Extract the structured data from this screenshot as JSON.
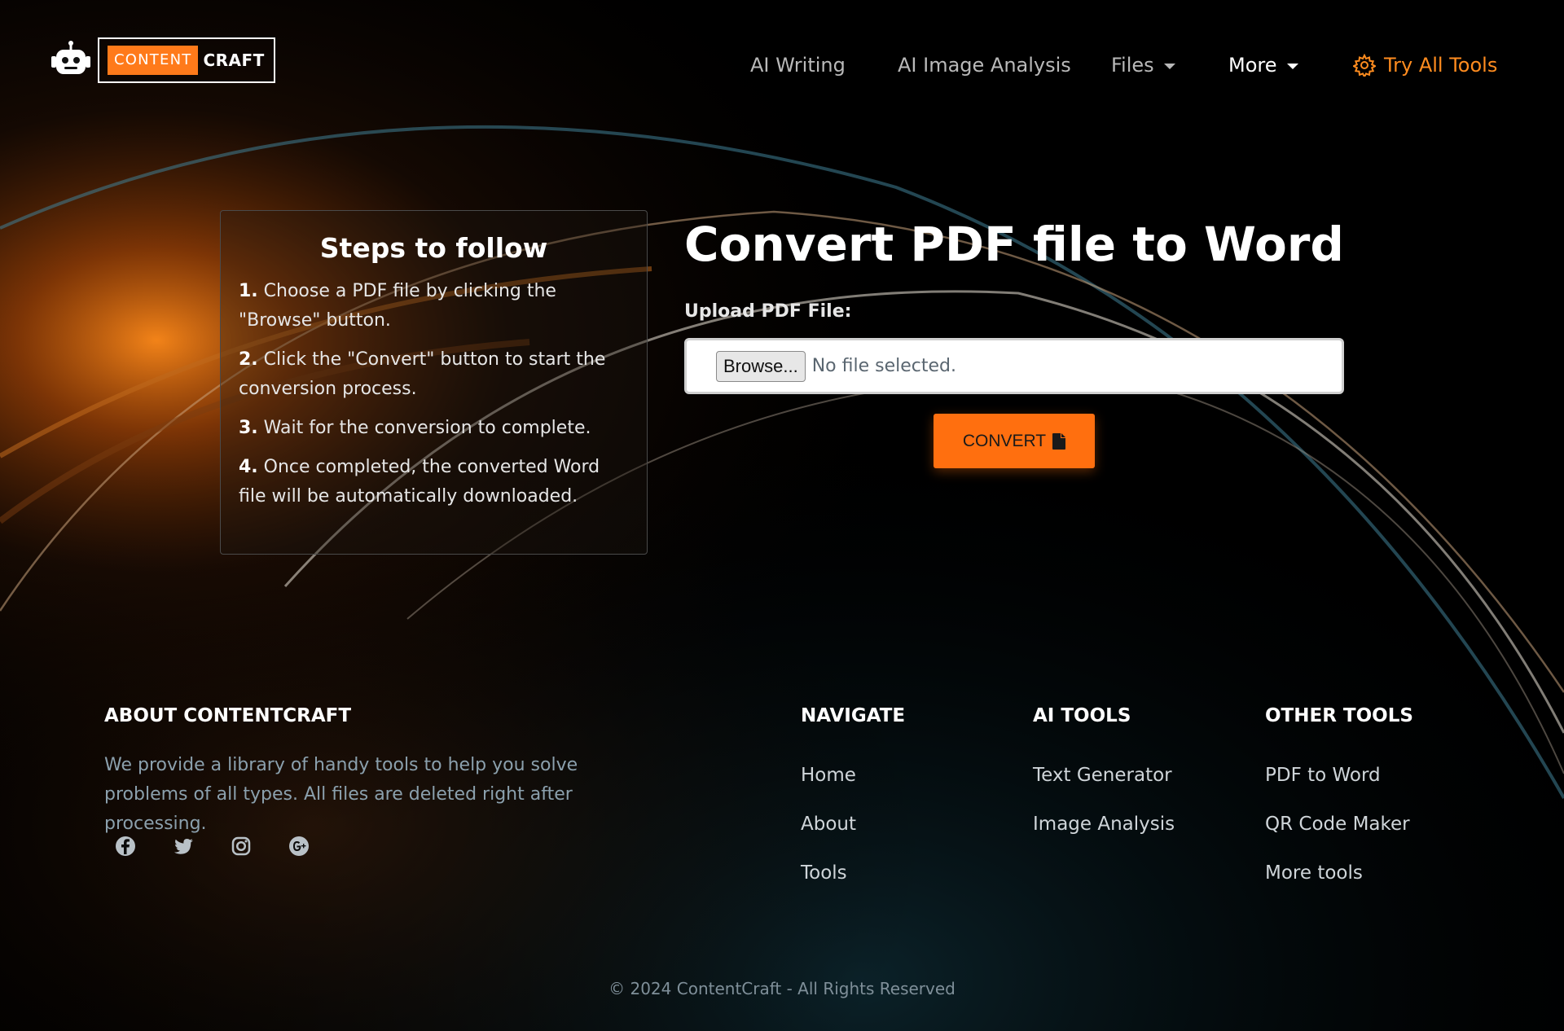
{
  "brand": {
    "logo_part1": "CONTENT",
    "logo_part2": "CRAFT",
    "icon": "robot-icon"
  },
  "nav": {
    "links": [
      "AI Writing",
      "AI Image Analysis",
      "Files",
      "More"
    ],
    "cta_label": "Try All Tools",
    "cta_icon": "gear-icon",
    "accent_color": "#ff8c1f"
  },
  "steps": {
    "title": "Steps to follow",
    "items": [
      {
        "num": "1.",
        "text": "Choose a PDF file by clicking the \"Browse\" button."
      },
      {
        "num": "2.",
        "text": "Click the \"Convert\" button to start the conversion process."
      },
      {
        "num": "3.",
        "text": "Wait for the conversion to complete."
      },
      {
        "num": "4.",
        "text": "Once completed, the converted Word file will be automatically downloaded."
      }
    ]
  },
  "converter": {
    "title": "Convert PDF file to Word",
    "upload_label": "Upload PDF File:",
    "browse_label": "Browse...",
    "file_status": "No file selected.",
    "convert_label": "CONVERT",
    "convert_icon": "file-icon",
    "button_color": "#ff6f0f"
  },
  "footer": {
    "about_heading": "ABOUT CONTENTCRAFT",
    "about_text": "We provide a library of handy tools to help you solve problems of all types. All files are deleted right after processing.",
    "social_icons": [
      "facebook-icon",
      "twitter-icon",
      "instagram-icon",
      "google-plus-icon"
    ],
    "navigate": {
      "heading": "NAVIGATE",
      "links": [
        "Home",
        "About",
        "Tools"
      ]
    },
    "ai_tools": {
      "heading": "AI TOOLS",
      "links": [
        "Text Generator",
        "Image Analysis"
      ]
    },
    "other_tools": {
      "heading": "OTHER TOOLS",
      "links": [
        "PDF to Word",
        "QR Code Maker",
        "More tools"
      ]
    },
    "copyright": "© 2024 ContentCraft - All Rights Reserved"
  }
}
